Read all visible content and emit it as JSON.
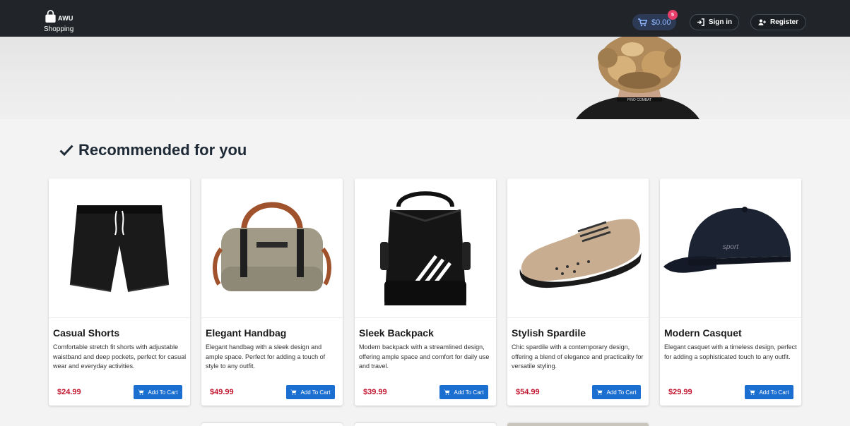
{
  "header": {
    "logo_brand": "AWU",
    "logo_subtitle": "Shopping",
    "cart_total": "$0.00",
    "cart_count": "5",
    "signin_label": "Sign in",
    "register_label": "Register"
  },
  "section": {
    "title": "Recommended for you",
    "icon": "check-icon"
  },
  "products": [
    {
      "name": "Casual Shorts",
      "description": "Comfortable stretch fit shorts with adjustable waistband and deep pockets, perfect for casual wear and everyday activities.",
      "price": "$24.99",
      "button": "Add To Cart"
    },
    {
      "name": "Elegant Handbag",
      "description": "Elegant handbag with a sleek design and ample space. Perfect for adding a touch of style to any outfit.",
      "price": "$49.99",
      "button": "Add To Cart"
    },
    {
      "name": "Sleek Backpack",
      "description": "Modern backpack with a streamlined design, offering ample space and comfort for daily use and travel.",
      "price": "$39.99",
      "button": "Add To Cart"
    },
    {
      "name": "Stylish Spardile",
      "description": "Chic spardile with a contemporary design, offering a blend of elegance and practicality for versatile styling.",
      "price": "$54.99",
      "button": "Add To Cart"
    },
    {
      "name": "Modern Casquet",
      "description": "Elegant casquet with a timeless design, perfect for adding a sophisticated touch to any outfit.",
      "price": "$29.99",
      "button": "Add To Cart"
    }
  ],
  "colors": {
    "header_bg": "#212529",
    "accent_blue": "#1b6fd1",
    "price_red": "#c0122c",
    "badge_pink": "#e83e6a"
  }
}
